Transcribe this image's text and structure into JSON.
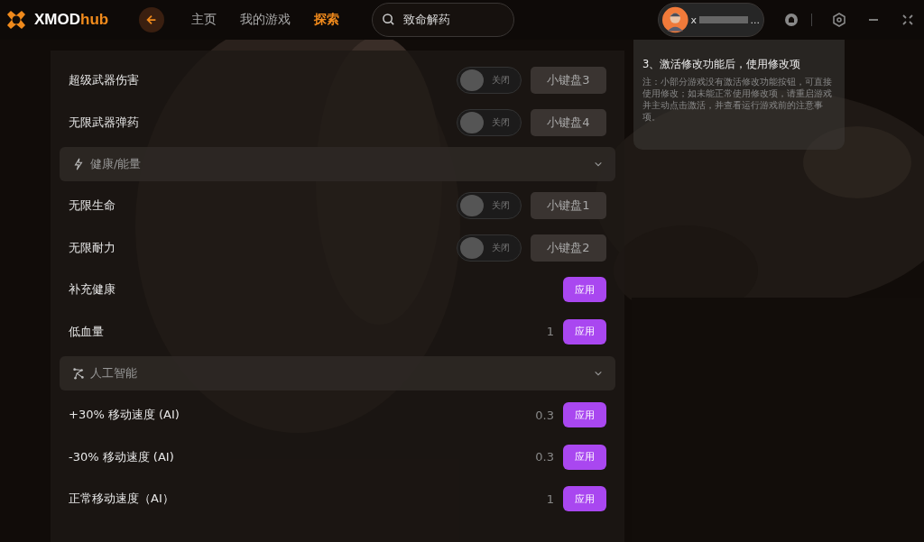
{
  "header": {
    "logo": "XMOD",
    "logo_accent": "hub",
    "nav": [
      {
        "label": "主页",
        "selected": false
      },
      {
        "label": "我的游戏",
        "selected": false
      },
      {
        "label": "探索",
        "selected": true
      }
    ],
    "search": {
      "value": "致命解药"
    },
    "user": {
      "name_start": "x",
      "name_end": "..."
    }
  },
  "items": [
    {
      "kind": "toggle",
      "label": "超级武器伤害",
      "on": false,
      "state_text": "关闭",
      "hotkey": "小键盘3"
    },
    {
      "kind": "toggle",
      "label": "无限武器弹药",
      "on": false,
      "state_text": "关闭",
      "hotkey": "小键盘4"
    },
    {
      "kind": "section",
      "label": "健康/能量",
      "expanded": true
    },
    {
      "kind": "toggle",
      "label": "无限生命",
      "on": false,
      "state_text": "关闭",
      "hotkey": "小键盘1"
    },
    {
      "kind": "toggle",
      "label": "无限耐力",
      "on": false,
      "state_text": "关闭",
      "hotkey": "小键盘2"
    },
    {
      "kind": "apply",
      "label": "补充健康",
      "button": "应用"
    },
    {
      "kind": "apply",
      "label": "低血量",
      "value": "1",
      "button": "应用"
    },
    {
      "kind": "section",
      "label": "人工智能",
      "expanded": true
    },
    {
      "kind": "apply",
      "label": "+30% 移动速度 (AI)",
      "value": "0.3",
      "button": "应用"
    },
    {
      "kind": "apply",
      "label": "-30% 移动速度 (AI)",
      "value": "0.3",
      "button": "应用"
    },
    {
      "kind": "apply",
      "label": "正常移动速度（AI）",
      "value": "1",
      "button": "应用"
    }
  ],
  "guide": {
    "title": "3、激活修改功能后，使用修改项",
    "note": "注：小部分游戏没有激活修改功能按钮，可直接使用修改；如未能正常使用修改项，请重启游戏并主动点击激活，并查看运行游戏前的注意事项。"
  }
}
